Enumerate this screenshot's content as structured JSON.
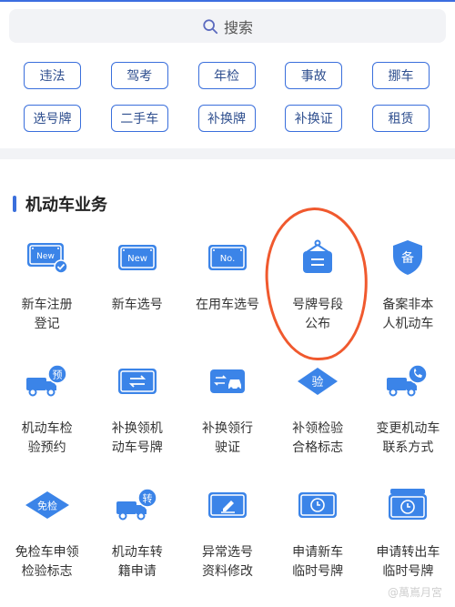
{
  "search": {
    "placeholder": "搜索",
    "icon": "search-icon"
  },
  "chips": [
    [
      "违法",
      "驾考",
      "年检",
      "事故",
      "挪车"
    ],
    [
      "选号牌",
      "二手车",
      "补换牌",
      "补换证",
      "租赁"
    ]
  ],
  "section": {
    "title": "机动车业务"
  },
  "services": [
    [
      {
        "label": "新车注册\n登记",
        "icon": "new-plate-check-icon"
      },
      {
        "label": "新车选号",
        "icon": "new-plate-icon"
      },
      {
        "label": "在用车选号",
        "icon": "no-plate-icon"
      },
      {
        "label": "号牌号段\n公布",
        "icon": "hanging-sign-icon"
      },
      {
        "label": "备案非本\n人机动车",
        "icon": "shield-bei-icon"
      }
    ],
    [
      {
        "label": "机动车检\n验预约",
        "icon": "truck-yu-icon"
      },
      {
        "label": "补换领机\n动车号牌",
        "icon": "plate-swap-icon"
      },
      {
        "label": "补换领行\n驶证",
        "icon": "license-car-icon"
      },
      {
        "label": "补领检验\n合格标志",
        "icon": "diamond-yan-icon"
      },
      {
        "label": "变更机动车\n联系方式",
        "icon": "truck-phone-icon"
      }
    ],
    [
      {
        "label": "免检车申领\n检验标志",
        "icon": "diamond-mianjian-icon"
      },
      {
        "label": "机动车转\n籍申请",
        "icon": "truck-zhuan-icon"
      },
      {
        "label": "异常选号\n资料修改",
        "icon": "edit-plate-icon"
      },
      {
        "label": "申请新车\n临时号牌",
        "icon": "clock-plate-icon"
      },
      {
        "label": "申请转出车\n临时号牌",
        "icon": "clock-plate-out-icon"
      }
    ]
  ],
  "watermark": "@萬嶌月宮",
  "colors": {
    "accent": "#3a6fdc",
    "icon_blue": "#3b84e8",
    "highlight": "#f0592e"
  }
}
